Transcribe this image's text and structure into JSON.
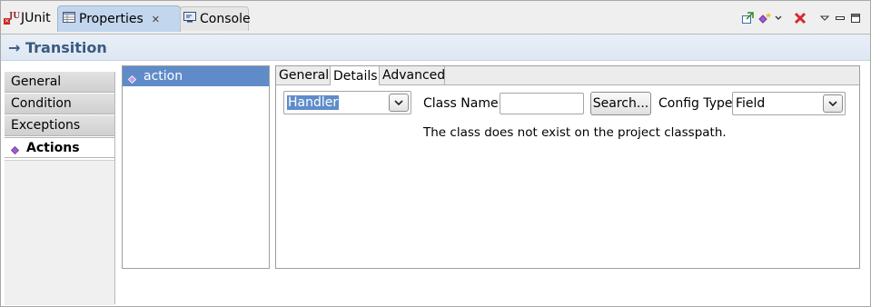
{
  "tabs": [
    {
      "label": "JUnit",
      "icon": "junit-icon"
    },
    {
      "label": "Properties",
      "icon": "properties-icon"
    },
    {
      "label": "Console",
      "icon": "console-icon"
    }
  ],
  "toolbar": {
    "icons": [
      "pin-editor-icon",
      "new-node-icon",
      "dropdown-chevron-icon",
      "remove-red-x-icon",
      "view-menu-icon",
      "minimize-icon",
      "maximize-icon"
    ]
  },
  "title": {
    "arrow": "→",
    "label": "Transition"
  },
  "nav": {
    "items": [
      {
        "label": "General",
        "active": false
      },
      {
        "label": "Condition",
        "active": false
      },
      {
        "label": "Exceptions",
        "active": false
      },
      {
        "label": "Actions",
        "active": true
      }
    ]
  },
  "actions_list": {
    "items": [
      {
        "label": "action",
        "selected": true
      }
    ]
  },
  "detail": {
    "tabs": [
      {
        "label": "General",
        "active": false
      },
      {
        "label": "Details",
        "active": true
      },
      {
        "label": "Advanced",
        "active": false
      }
    ],
    "handler_combo": {
      "value": "Handler"
    },
    "class_name": {
      "label": "Class Name",
      "value": ""
    },
    "search_button": {
      "label": "Search..."
    },
    "config_type": {
      "label": "Config Type",
      "value": "Field"
    },
    "message": "The class does not exist on the project classpath."
  },
  "colors": {
    "selection": "#5f8cc9",
    "title_text": "#3a5a80",
    "active_tab": "#c2d6ee",
    "error_red": "#d42a2a",
    "action_diamond": "#a25bd0"
  }
}
